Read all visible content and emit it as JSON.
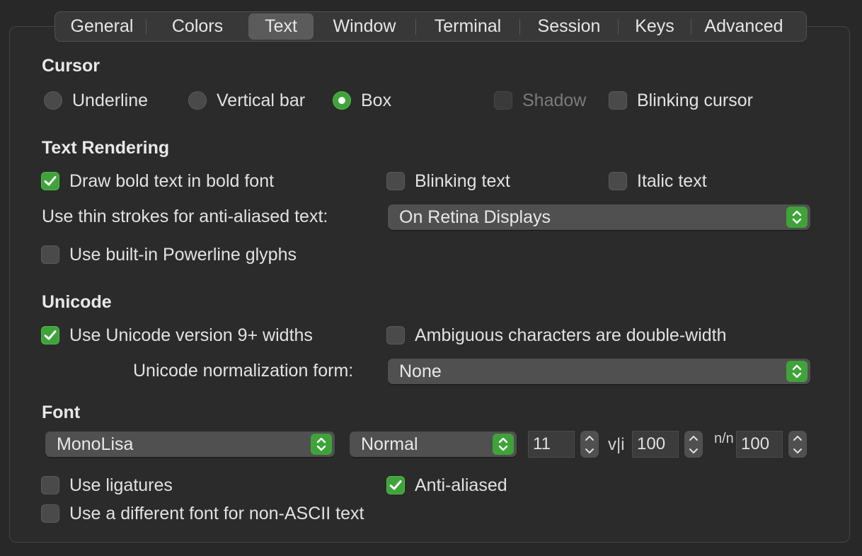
{
  "tabs": [
    "General",
    "Colors",
    "Text",
    "Window",
    "Terminal",
    "Session",
    "Keys",
    "Advanced"
  ],
  "active_tab": "Text",
  "cursor": {
    "heading": "Cursor",
    "underline": "Underline",
    "vertical_bar": "Vertical bar",
    "box": "Box",
    "selected": "Box",
    "shadow": "Shadow",
    "blinking_cursor": "Blinking cursor"
  },
  "rendering": {
    "heading": "Text Rendering",
    "bold": "Draw bold text in bold font",
    "blinking_text": "Blinking text",
    "italic_text": "Italic text",
    "thin_strokes_label": "Use thin strokes for anti-aliased text:",
    "thin_strokes_value": "On Retina Displays",
    "powerline": "Use built-in Powerline glyphs"
  },
  "unicode": {
    "heading": "Unicode",
    "version9": "Use Unicode version 9+ widths",
    "ambiguous": "Ambiguous characters are double-width",
    "normalization_label": "Unicode normalization form:",
    "normalization_value": "None"
  },
  "font": {
    "heading": "Font",
    "family": "MonoLisa",
    "weight": "Normal",
    "size": "11",
    "v_spacing_glyph": "v|i",
    "v_spacing": "100",
    "h_spacing_glyph": "n/n",
    "h_spacing": "100",
    "ligatures": "Use ligatures",
    "anti_aliased": "Anti-aliased",
    "non_ascii": "Use a different font for non-ASCII text"
  },
  "colors": {
    "accent": "#3fa33a",
    "background": "#282828"
  },
  "icons": [
    "checkmark-icon",
    "up-down-chevron-icon",
    "stepper-up-icon",
    "stepper-down-icon"
  ]
}
